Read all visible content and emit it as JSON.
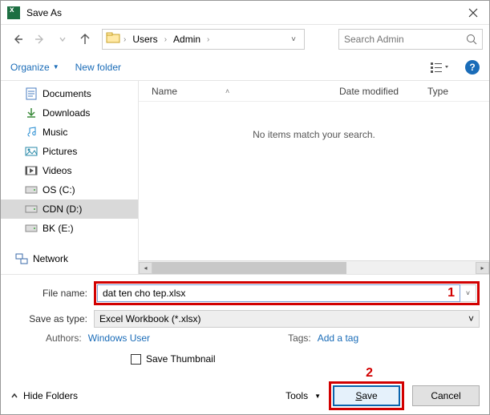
{
  "window": {
    "title": "Save As"
  },
  "nav": {
    "crumbs": [
      "Users",
      "Admin"
    ],
    "search_placeholder": "Search Admin"
  },
  "toolbar": {
    "organize": "Organize",
    "new_folder": "New folder"
  },
  "tree": {
    "items": [
      {
        "label": "Documents"
      },
      {
        "label": "Downloads"
      },
      {
        "label": "Music"
      },
      {
        "label": "Pictures"
      },
      {
        "label": "Videos"
      },
      {
        "label": "OS (C:)"
      },
      {
        "label": "CDN (D:)"
      },
      {
        "label": "BK (E:)"
      }
    ],
    "network": "Network"
  },
  "list": {
    "columns": {
      "name": "Name",
      "date": "Date modified",
      "type": "Type"
    },
    "empty_text": "No items match your search."
  },
  "form": {
    "filename_label": "File name:",
    "filename_value": "dat ten cho tep.xlsx",
    "type_label": "Save as type:",
    "type_value": "Excel Workbook (*.xlsx)",
    "authors_label": "Authors:",
    "authors_value": "Windows User",
    "tags_label": "Tags:",
    "tags_value": "Add a tag",
    "thumbnail": "Save Thumbnail",
    "callout1": "1",
    "callout2": "2"
  },
  "footer": {
    "hide": "Hide Folders",
    "tools": "Tools",
    "save": "Save",
    "cancel": "Cancel"
  }
}
